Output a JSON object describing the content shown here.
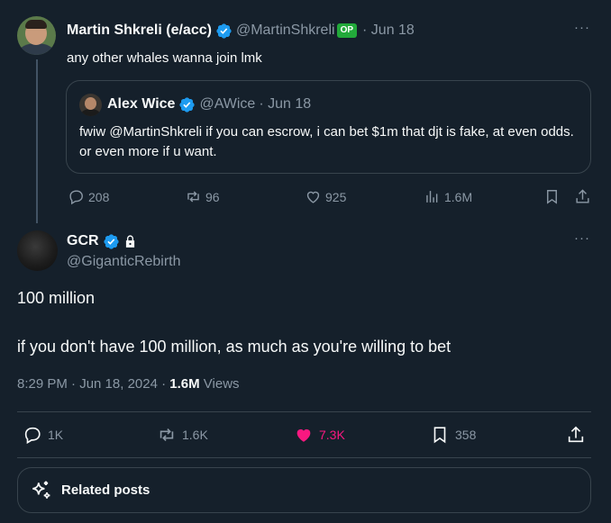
{
  "colors": {
    "accent": "#1d9bf0",
    "like": "#f91880",
    "op_badge": "#22a93a",
    "background": "#15202b"
  },
  "parent_tweet": {
    "author": "Martin Shkreli (e/acc)",
    "handle": "@MartinShkreli",
    "op_badge": "OP",
    "date": "· Jun 18",
    "more": "···",
    "text": "any other whales wanna join lmk",
    "quote": {
      "author": "Alex Wice",
      "handle": "@AWice",
      "date": "· Jun 18",
      "text": "fwiw @MartinShkreli  if you can escrow, i can bet $1m that djt is fake, at even odds.  or even more if u want."
    },
    "actions": {
      "replies": "208",
      "reposts": "96",
      "likes": "925",
      "views": "1.6M"
    },
    "icons": [
      "reply-icon",
      "repost-icon",
      "like-icon",
      "views-icon",
      "bookmark-icon",
      "share-icon"
    ]
  },
  "main_tweet": {
    "author": "GCR",
    "handle": "@GiganticRebirth",
    "more": "···",
    "line1": "100 million",
    "line2": "if you don't have 100 million, as much as you're willing to bet",
    "time": "8:29 PM · Jun 18, 2024 · ",
    "views_count": "1.6M",
    "views_label": " Views",
    "actions": {
      "replies": "1K",
      "reposts": "1.6K",
      "likes": "7.3K",
      "bookmarks": "358"
    }
  },
  "related": {
    "label": "Related posts",
    "icon": "sparkle-icon"
  }
}
